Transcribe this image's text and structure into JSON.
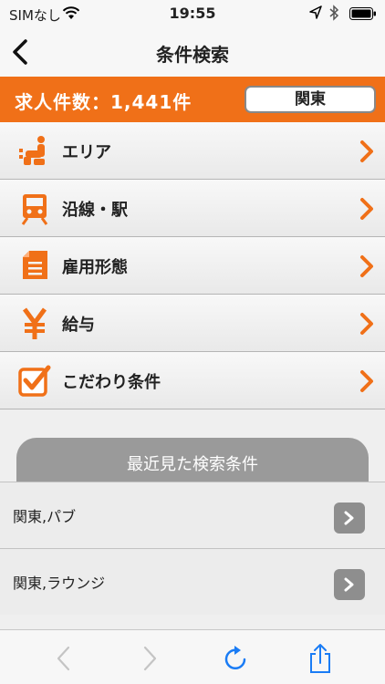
{
  "status_bar": {
    "carrier": "SIMなし",
    "time": "19:55",
    "icons": [
      "wifi-icon",
      "location-icon",
      "bluetooth-icon",
      "battery-icon"
    ]
  },
  "nav": {
    "title": "条件検索",
    "back_icon": "chevron-left-icon"
  },
  "count_bar": {
    "text": "求人件数：1,441件",
    "region_button": "関東",
    "color": "#f07018"
  },
  "menu": {
    "accent_color": "#f07018",
    "items": [
      {
        "label": "エリア",
        "icon": "area-person-icon"
      },
      {
        "label": "沿線・駅",
        "icon": "train-icon"
      },
      {
        "label": "雇用形態",
        "icon": "document-icon"
      },
      {
        "label": "給与",
        "icon": "yen-icon"
      },
      {
        "label": "こだわり条件",
        "icon": "checkbox-icon"
      }
    ]
  },
  "recent": {
    "title": "最近見た検索条件",
    "items": [
      {
        "label": "関東,パブ"
      },
      {
        "label": "関東,ラウンジ"
      }
    ]
  },
  "toolbar": {
    "icons": [
      "back-arrow-icon",
      "forward-arrow-icon",
      "reload-icon",
      "share-icon"
    ],
    "accent_color": "#1a7cf5"
  }
}
